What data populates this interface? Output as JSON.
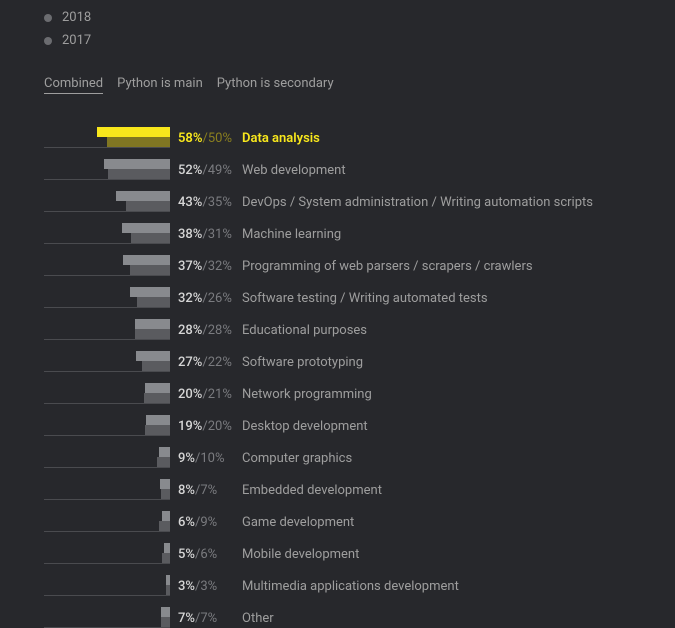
{
  "legend": [
    {
      "label": "2018"
    },
    {
      "label": "2017"
    }
  ],
  "tabs": [
    {
      "label": "Combined",
      "active": true
    },
    {
      "label": "Python is main",
      "active": false
    },
    {
      "label": "Python is secondary",
      "active": false
    }
  ],
  "chart_data": {
    "type": "bar",
    "categories": [
      "Data analysis",
      "Web development",
      "DevOps / System administration / Writing automation scripts",
      "Machine learning",
      "Programming of web parsers / scrapers / crawlers",
      "Software testing / Writing automated tests",
      "Educational purposes",
      "Software prototyping",
      "Network programming",
      "Desktop development",
      "Computer graphics",
      "Embedded development",
      "Game development",
      "Mobile development",
      "Multimedia applications development",
      "Other"
    ],
    "series": [
      {
        "name": "2018",
        "values": [
          58,
          52,
          43,
          38,
          37,
          32,
          28,
          27,
          20,
          19,
          9,
          8,
          6,
          5,
          3,
          7
        ]
      },
      {
        "name": "2017",
        "values": [
          50,
          49,
          35,
          31,
          32,
          26,
          28,
          22,
          21,
          20,
          10,
          7,
          9,
          6,
          3,
          7
        ]
      }
    ],
    "highlight_index": 0,
    "xlim": [
      0,
      100
    ]
  }
}
